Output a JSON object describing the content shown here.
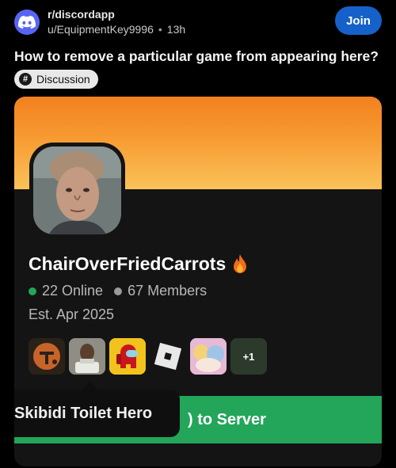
{
  "post": {
    "subreddit": "r/discordapp",
    "author": "u/EquipmentKey9996",
    "separator": "•",
    "time_ago": "13h",
    "join_label": "Join",
    "title": "How to remove a particular game from appearing here?",
    "flair": "Discussion",
    "flair_icon": "#"
  },
  "server_card": {
    "name": "ChairOverFriedCarrots",
    "online": "22 Online",
    "members": "67 Members",
    "established": "Est. Apr 2025",
    "games_overflow": "+1",
    "go_button_label": "Go to Server",
    "tooltip": "Skibidi Toilet Hero",
    "games": [
      "team-fortress-2-icon",
      "skibidi-toilet-hero-icon",
      "among-us-icon",
      "roblox-icon",
      "anime-game-icon"
    ]
  },
  "colors": {
    "join_button": "#1561c9",
    "banner_top": "#f2801f",
    "banner_bottom": "#fbc25a",
    "online_dot": "#23a55a",
    "go_button": "#23a55a"
  }
}
